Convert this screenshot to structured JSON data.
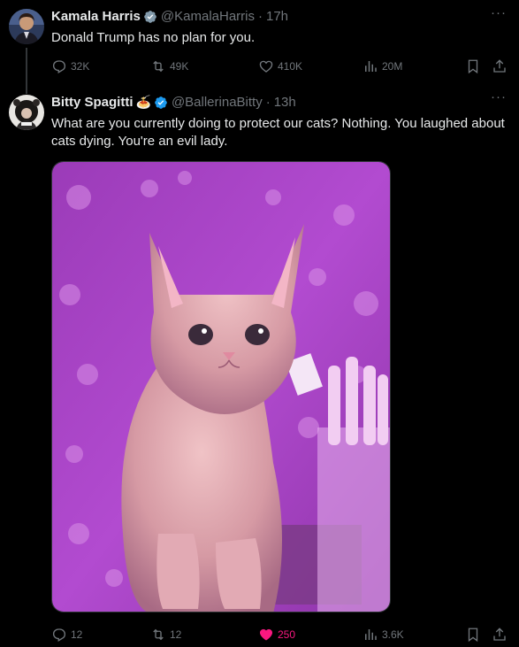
{
  "tweets": [
    {
      "author": "Kamala Harris",
      "handle": "@KamalaHarris",
      "time": "17h",
      "text": "Donald Trump has no plan for you.",
      "stats": {
        "replies": "32K",
        "retweets": "49K",
        "likes": "410K",
        "views": "20M"
      },
      "liked": false
    },
    {
      "author": "Bitty Spagitti",
      "emoji": "🍝",
      "handle": "@BallerinaBitty",
      "time": "13h",
      "text": "What are you currently doing to protect our cats? Nothing. You laughed about cats dying. You're an evil lady.",
      "stats": {
        "replies": "12",
        "retweets": "12",
        "likes": "250",
        "views": "3.6K"
      },
      "liked": true
    }
  ],
  "separator": "·",
  "more_label": "···",
  "colors": {
    "verified": "#1d9bf0",
    "muted": "#71767b",
    "like_active": "#f91880",
    "media_bg": "#b03ec8"
  }
}
